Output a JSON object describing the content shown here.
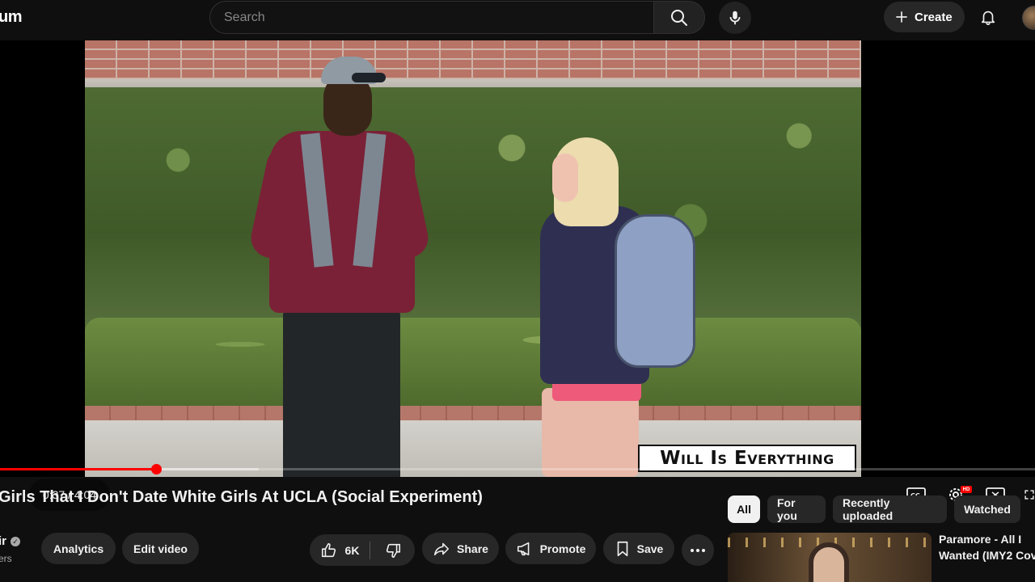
{
  "header": {
    "logo_text": "um",
    "search_placeholder": "Search",
    "create_label": "Create",
    "icons": {
      "search": "search-icon",
      "mic": "mic-icon",
      "create": "plus-icon",
      "notifications": "bell-icon"
    }
  },
  "player": {
    "watermark": "Will Is Everything",
    "current_time": "0:37",
    "duration": "4:04",
    "time_display": "0:37 / 4:04",
    "progress_fraction": 0.151,
    "buffered_fraction": 0.25,
    "hd_badge": "HD",
    "controls": [
      "closed-captions-icon",
      "settings-icon",
      "theater-mode-icon",
      "fullscreen-icon"
    ]
  },
  "video": {
    "title": "Girls That I Don't Date White Girls At UCLA (Social Experiment)",
    "channel_name": "ir",
    "subscribers": "ers",
    "analytics_label": "Analytics",
    "edit_label": "Edit video",
    "like_count": "6K",
    "share_label": "Share",
    "promote_label": "Promote",
    "save_label": "Save"
  },
  "sidebar": {
    "chips": [
      {
        "label": "All",
        "active": true
      },
      {
        "label": "For you",
        "active": false
      },
      {
        "label": "Recently uploaded",
        "active": false
      },
      {
        "label": "Watched",
        "active": false
      }
    ],
    "recommended": [
      {
        "title": "Paramore - All I Wanted (IMY2 Cov"
      }
    ]
  },
  "colors": {
    "background": "#0f0f0f",
    "progress": "#ff0000",
    "button": "#272727",
    "chip_active": "#f1f1f1"
  }
}
